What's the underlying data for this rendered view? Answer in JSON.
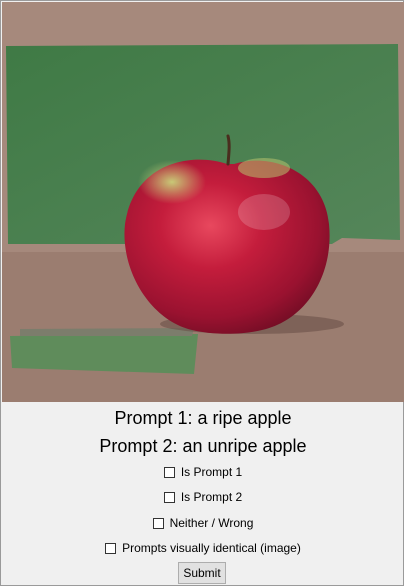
{
  "prompts": {
    "prompt1": "Prompt 1: a ripe apple",
    "prompt2": "Prompt 2: an unripe apple"
  },
  "options": [
    {
      "label": "Is Prompt 1",
      "checked": false
    },
    {
      "label": "Is Prompt 2",
      "checked": false
    },
    {
      "label": "Neither / Wrong",
      "checked": false
    },
    {
      "label": "Prompts visually identical (image)",
      "checked": false
    }
  ],
  "submit_label": "Submit",
  "colors": {
    "window_bg": "#f0f0f0",
    "backdrop_brown": "#a4877a",
    "backdrop_green": "#4a7f4c",
    "apple_red": "#b51a36"
  }
}
